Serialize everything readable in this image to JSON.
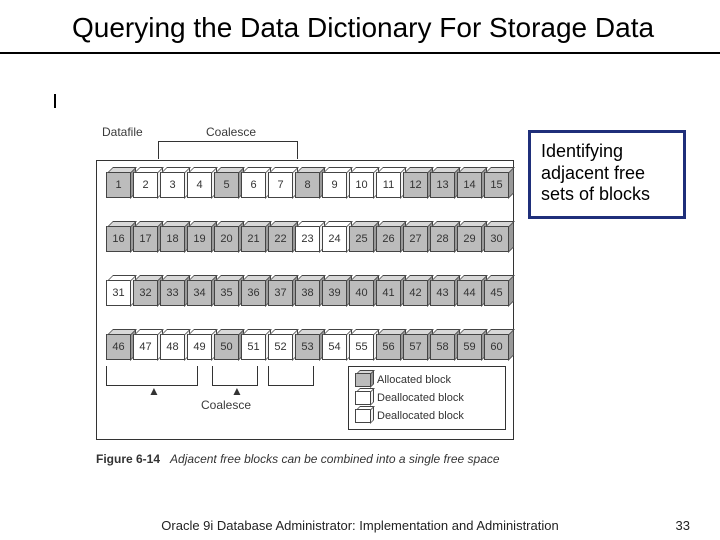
{
  "title": "Querying the Data Dictionary For Storage Data",
  "callout": "Identifying adjacent free sets of blocks",
  "figure": {
    "datafile_label": "Datafile",
    "coalesce_label": "Coalesce",
    "rows": [
      [
        {
          "n": "1",
          "a": true
        },
        {
          "n": "2",
          "a": false
        },
        {
          "n": "3",
          "a": false
        },
        {
          "n": "4",
          "a": false
        },
        {
          "n": "5",
          "a": true
        },
        {
          "n": "6",
          "a": false
        },
        {
          "n": "7",
          "a": false
        },
        {
          "n": "8",
          "a": true
        },
        {
          "n": "9",
          "a": false
        },
        {
          "n": "10",
          "a": false
        },
        {
          "n": "11",
          "a": false
        },
        {
          "n": "12",
          "a": true
        },
        {
          "n": "13",
          "a": true
        },
        {
          "n": "14",
          "a": true
        },
        {
          "n": "15",
          "a": true
        }
      ],
      [
        {
          "n": "16",
          "a": true
        },
        {
          "n": "17",
          "a": true
        },
        {
          "n": "18",
          "a": true
        },
        {
          "n": "19",
          "a": true
        },
        {
          "n": "20",
          "a": true
        },
        {
          "n": "21",
          "a": true
        },
        {
          "n": "22",
          "a": true
        },
        {
          "n": "23",
          "a": false
        },
        {
          "n": "24",
          "a": false
        },
        {
          "n": "25",
          "a": true
        },
        {
          "n": "26",
          "a": true
        },
        {
          "n": "27",
          "a": true
        },
        {
          "n": "28",
          "a": true
        },
        {
          "n": "29",
          "a": true
        },
        {
          "n": "30",
          "a": true
        }
      ],
      [
        {
          "n": "31",
          "a": false
        },
        {
          "n": "32",
          "a": true
        },
        {
          "n": "33",
          "a": true
        },
        {
          "n": "34",
          "a": true
        },
        {
          "n": "35",
          "a": true
        },
        {
          "n": "36",
          "a": true
        },
        {
          "n": "37",
          "a": true
        },
        {
          "n": "38",
          "a": true
        },
        {
          "n": "39",
          "a": true
        },
        {
          "n": "40",
          "a": true
        },
        {
          "n": "41",
          "a": true
        },
        {
          "n": "42",
          "a": true
        },
        {
          "n": "43",
          "a": true
        },
        {
          "n": "44",
          "a": true
        },
        {
          "n": "45",
          "a": true
        }
      ],
      [
        {
          "n": "46",
          "a": true
        },
        {
          "n": "47",
          "a": false
        },
        {
          "n": "48",
          "a": false
        },
        {
          "n": "49",
          "a": false
        },
        {
          "n": "50",
          "a": true
        },
        {
          "n": "51",
          "a": false
        },
        {
          "n": "52",
          "a": false
        },
        {
          "n": "53",
          "a": true
        },
        {
          "n": "54",
          "a": false
        },
        {
          "n": "55",
          "a": false
        },
        {
          "n": "56",
          "a": true
        },
        {
          "n": "57",
          "a": true
        },
        {
          "n": "58",
          "a": true
        },
        {
          "n": "59",
          "a": true
        },
        {
          "n": "60",
          "a": true
        }
      ]
    ],
    "legend": [
      {
        "label": "Allocated block",
        "a": true
      },
      {
        "label": "Deallocated block",
        "a": false
      },
      {
        "label": "Deallocated block",
        "a": false
      }
    ],
    "caption_prefix": "Figure 6-14",
    "caption_text": "Adjacent free blocks can be combined into a single free space"
  },
  "footer": {
    "text": "Oracle 9i Database Administrator: Implementation and Administration",
    "page": "33"
  }
}
